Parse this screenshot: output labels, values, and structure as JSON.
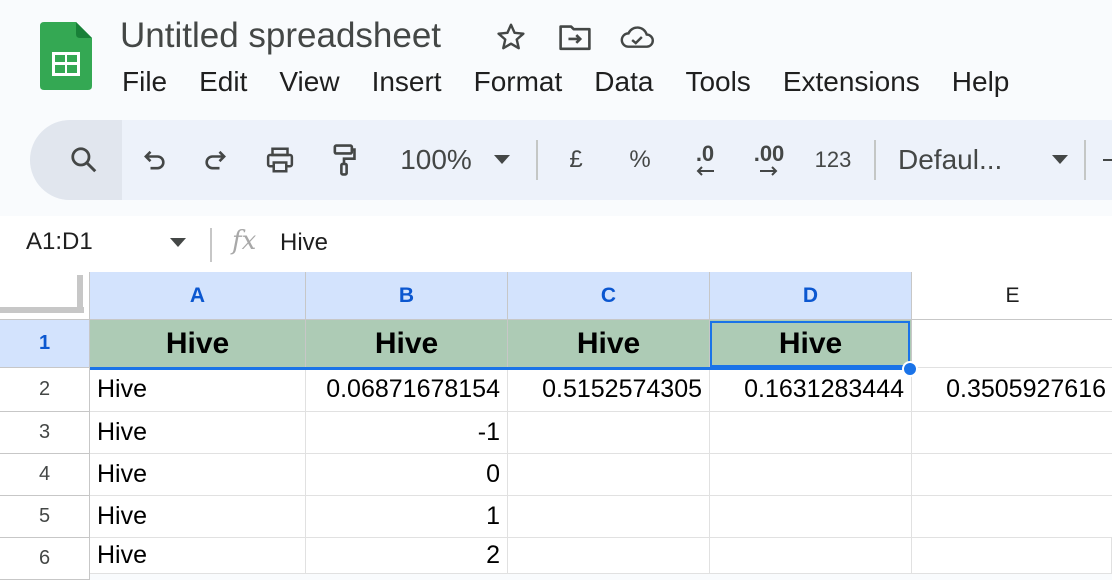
{
  "app": {
    "title": "Untitled spreadsheet",
    "brand_color": "#34a853"
  },
  "title_icons": [
    "star-icon",
    "move-to-folder-icon",
    "cloud-saved-icon"
  ],
  "menu": [
    "File",
    "Edit",
    "View",
    "Insert",
    "Format",
    "Data",
    "Tools",
    "Extensions",
    "Help"
  ],
  "toolbar": {
    "zoom": "100%",
    "currency": "£",
    "percent": "%",
    "decrease_decimal": ".0",
    "increase_decimal": ".00",
    "more_formats": "123",
    "font": "Defaul...",
    "icons": [
      "search-icon",
      "undo-icon",
      "redo-icon",
      "print-icon",
      "paint-format-icon"
    ]
  },
  "formula_bar": {
    "name_box": "A1:D1",
    "fx": "fx",
    "value": "Hive"
  },
  "grid": {
    "columns": [
      "A",
      "B",
      "C",
      "D",
      "E"
    ],
    "selected_columns": [
      "A",
      "B",
      "C",
      "D"
    ],
    "header_fill_color": "#adcbb5",
    "selection_color": "#1a73e8",
    "rows": [
      {
        "num": "1",
        "cells": [
          "Hive",
          "Hive",
          "Hive",
          "Hive",
          ""
        ]
      },
      {
        "num": "2",
        "cells": [
          "Hive",
          "0.06871678154",
          "0.5152574305",
          "0.1631283444",
          "0.3505927616"
        ]
      },
      {
        "num": "3",
        "cells": [
          "Hive",
          "-1",
          "",
          "",
          ""
        ]
      },
      {
        "num": "4",
        "cells": [
          "Hive",
          "0",
          "",
          "",
          ""
        ]
      },
      {
        "num": "5",
        "cells": [
          "Hive",
          "1",
          "",
          "",
          ""
        ]
      },
      {
        "num": "6",
        "cells": [
          "Hive",
          "2",
          "",
          "",
          ""
        ]
      }
    ]
  }
}
